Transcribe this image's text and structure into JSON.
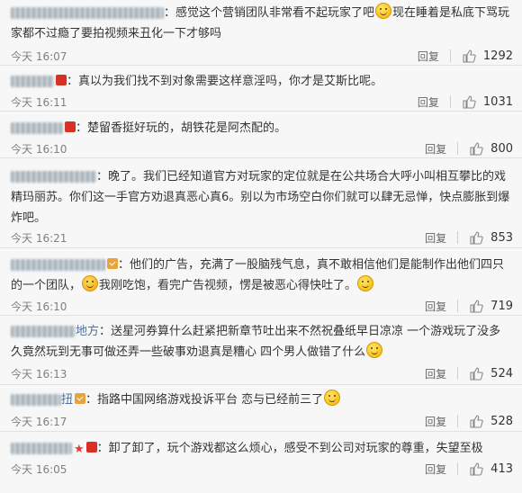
{
  "reply_label": "回复",
  "comments": [
    {
      "segments": [
        "感觉这个营销团队非常看不起玩家了吧",
        "现在睡着是私底下骂玩家都不过瘾了要拍视频来丑化一下才够吗"
      ],
      "time": "今天 16:07",
      "likes": "1292"
    },
    {
      "segments": [
        "真以为我们找不到对象需要这样意淫吗，你才是艾斯比呢。"
      ],
      "time": "今天 16:11",
      "likes": "1031"
    },
    {
      "segments": [
        "楚留香挺好玩的，胡铁花是阿杰配的。"
      ],
      "time": "今天 16:10",
      "likes": "800"
    },
    {
      "segments": [
        "晚了。我们已经知道官方对玩家的定位就是在公共场合大呼小叫相互攀比的戏精玛丽苏。你们这一手官方劝退真恶心真6。别以为市场空白你们就可以肆无忌惮，快点膨胀到爆炸吧。"
      ],
      "time": "今天 16:21",
      "likes": "853"
    },
    {
      "segments": [
        "他们的广告，充满了一股脑残气息，真不敢相信他们是能制作出他们四只的一个团队，",
        "我刚吃饱，看完广告视频，愣是被恶心得快吐了。"
      ],
      "time": "今天 16:10",
      "likes": "719"
    },
    {
      "name_suffix": "地方",
      "segments": [
        "送星河券算什么赶紧把新章节吐出来不然祝叠纸早日凉凉 一个游戏玩了没多久竟然玩到无事可做还弄一些破事劝退真是糟心 四个男人做错了什么"
      ],
      "time": "今天 16:13",
      "likes": "524"
    },
    {
      "name_suffix": "扭",
      "segments": [
        "指路中国网络游戏投诉平台 恋与已经前三了"
      ],
      "time": "今天 16:17",
      "likes": "528"
    },
    {
      "segments": [
        "卸了卸了，玩个游戏都这么烦心，感受不到公司对玩家的尊重，失望至极"
      ],
      "time": "今天 16:05",
      "likes": "413"
    }
  ]
}
